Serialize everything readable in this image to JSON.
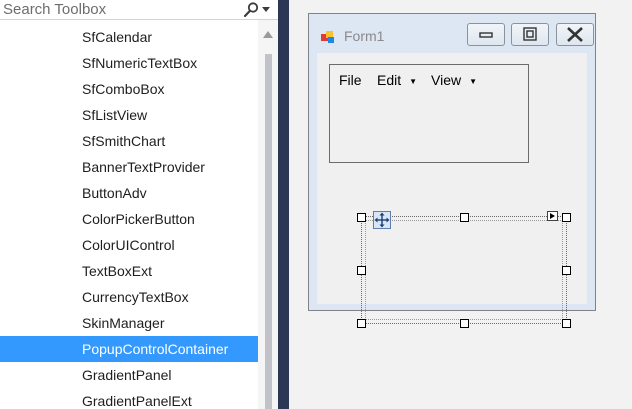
{
  "toolbox": {
    "search_placeholder": "Search Toolbox",
    "items": [
      {
        "label": "SfCalendar"
      },
      {
        "label": "SfNumericTextBox"
      },
      {
        "label": "SfComboBox"
      },
      {
        "label": "SfListView"
      },
      {
        "label": "SfSmithChart"
      },
      {
        "label": "BannerTextProvider"
      },
      {
        "label": "ButtonAdv"
      },
      {
        "label": "ColorPickerButton"
      },
      {
        "label": "ColorUIControl"
      },
      {
        "label": "TextBoxExt"
      },
      {
        "label": "CurrencyTextBox"
      },
      {
        "label": "SkinManager"
      },
      {
        "label": "PopupControlContainer"
      },
      {
        "label": "GradientPanel"
      },
      {
        "label": "GradientPanelExt"
      }
    ],
    "selected_item": "PopupControlContainer"
  },
  "form": {
    "title": "Form1",
    "menu": {
      "file": "File",
      "edit": "Edit",
      "view": "View"
    }
  },
  "colors": {
    "selection": "#3399ff",
    "splitter": "#2b3755",
    "form_frame": "#dce7f3"
  },
  "icons": {
    "search": "magnifier-icon",
    "move": "move-arrows-icon",
    "smart_tag": "smart-tag-arrow-icon",
    "form": "form-app-icon"
  }
}
